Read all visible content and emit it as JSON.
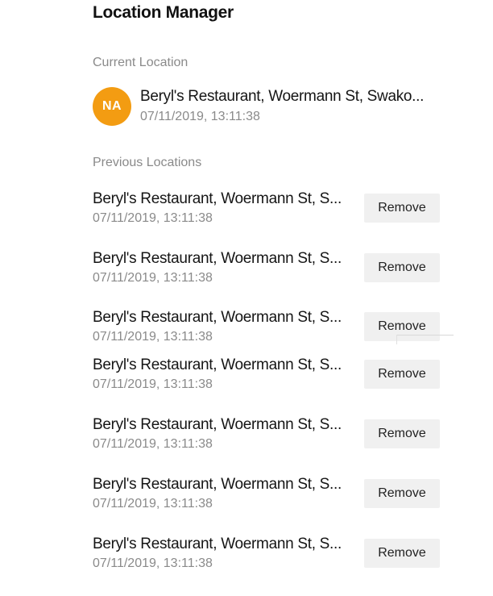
{
  "header": {
    "title": "Location Manager"
  },
  "current": {
    "section_label": "Current Location",
    "avatar_initials": "NA",
    "avatar_color": "#f39c12",
    "name": "Beryl's Restaurant, Woermann St, Swako...",
    "time": "07/11/2019, 13:11:38"
  },
  "previous": {
    "section_label": "Previous Locations",
    "items": [
      {
        "name": "Beryl's Restaurant, Woermann St, S...",
        "time": "07/11/2019, 13:11:38",
        "button": "Remove"
      },
      {
        "name": "Beryl's Restaurant, Woermann St, S...",
        "time": "07/11/2019, 13:11:38",
        "button": "Remove"
      },
      {
        "name": "Beryl's Restaurant, Woermann St, S...",
        "time": "07/11/2019, 13:11:38",
        "button": "Remove"
      },
      {
        "name": "Beryl's Restaurant, Woermann St, S...",
        "time": "07/11/2019, 13:11:38",
        "button": "Remove"
      },
      {
        "name": "Beryl's Restaurant, Woermann St, S...",
        "time": "07/11/2019, 13:11:38",
        "button": "Remove"
      },
      {
        "name": "Beryl's Restaurant, Woermann St, S...",
        "time": "07/11/2019, 13:11:38",
        "button": "Remove"
      },
      {
        "name": "Beryl's Restaurant, Woermann St, S...",
        "time": "07/11/2019, 13:11:38",
        "button": "Remove"
      }
    ]
  }
}
